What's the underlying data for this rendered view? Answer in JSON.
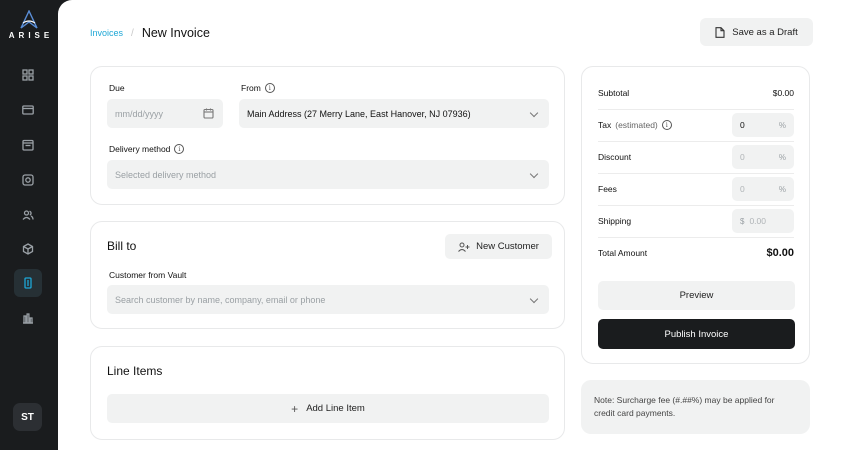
{
  "app": {
    "logo_text": "ARISE",
    "accent": "#1ea7d6"
  },
  "sidebar": {
    "items": [
      {
        "name": "dashboard",
        "icon": "grid-icon"
      },
      {
        "name": "cards",
        "icon": "credit-card-icon"
      },
      {
        "name": "calendar",
        "icon": "calendar-icon"
      },
      {
        "name": "settings",
        "icon": "cog-icon"
      },
      {
        "name": "customers",
        "icon": "users-icon"
      },
      {
        "name": "products",
        "icon": "cube-icon"
      },
      {
        "name": "invoices",
        "icon": "invoice-icon",
        "active": true
      },
      {
        "name": "reports",
        "icon": "bar-chart-icon"
      }
    ],
    "avatar_initials": "ST"
  },
  "header": {
    "breadcrumb_link": "Invoices",
    "breadcrumb_sep": "/",
    "title": "New Invoice",
    "save_draft_label": "Save as a Draft"
  },
  "details": {
    "due_label": "Due",
    "due_placeholder": "mm/dd/yyyy",
    "from_label": "From",
    "from_value": "Main Address (27 Merry Lane, East Hanover, NJ 07936)",
    "delivery_label": "Delivery method",
    "delivery_placeholder": "Selected delivery method"
  },
  "bill_to": {
    "title": "Bill to",
    "new_customer_label": "New Customer",
    "vault_label": "Customer from Vault",
    "vault_placeholder": "Search customer by name, company, email or phone"
  },
  "line_items": {
    "title": "Line Items",
    "add_label": "Add Line Item"
  },
  "summary": {
    "subtotal_label": "Subtotal",
    "subtotal_value": "$0.00",
    "tax_label": "Tax",
    "tax_note": "(estimated)",
    "tax_value": "0",
    "tax_unit": "%",
    "discount_label": "Discount",
    "discount_placeholder": "0",
    "discount_unit": "%",
    "fees_label": "Fees",
    "fees_placeholder": "0",
    "fees_unit": "%",
    "shipping_label": "Shipping",
    "shipping_prefix": "$",
    "shipping_placeholder": "0.00",
    "total_label": "Total Amount",
    "total_value": "$0.00",
    "preview_label": "Preview",
    "publish_label": "Publish Invoice"
  },
  "note": {
    "text": "Note: Surcharge fee (#.##%) may be applied for credit card payments."
  }
}
